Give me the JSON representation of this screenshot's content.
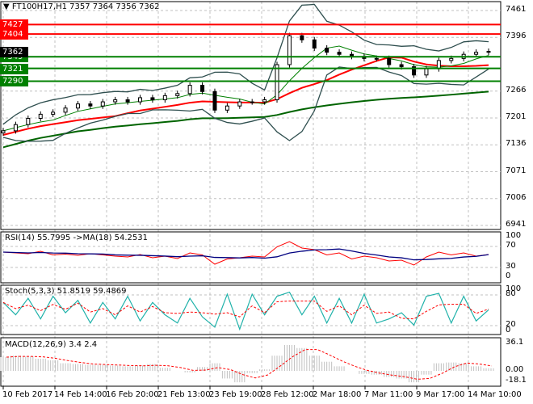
{
  "header": {
    "symbol_line": "FT100H17,H1  7357 7364 7356 7362",
    "menu_icon": "triangle-down-icon"
  },
  "price_axis": {
    "ticks": [
      "7461",
      "7396",
      "7266",
      "7201",
      "7136",
      "7071",
      "7006",
      "6941"
    ],
    "tick_values": [
      7461,
      7396,
      7266,
      7201,
      7136,
      7071,
      7006,
      6941
    ],
    "range": [
      6941,
      7461
    ]
  },
  "levels": [
    {
      "label": "7427",
      "value": 7427,
      "color": "#ff0000"
    },
    {
      "label": "7404",
      "value": 7404,
      "color": "#ff0000"
    },
    {
      "label": "7349",
      "value": 7349,
      "color": "#008000"
    },
    {
      "label": "7321",
      "value": 7321,
      "color": "#008000"
    },
    {
      "label": "7290",
      "value": 7290,
      "color": "#008000"
    }
  ],
  "current_price": {
    "label": "7362",
    "value": 7362
  },
  "chart_data": [
    {
      "type": "candlestick",
      "name": "FT100H17,H1",
      "closes": [
        7170,
        7185,
        7200,
        7210,
        7215,
        7225,
        7235,
        7230,
        7240,
        7245,
        7240,
        7250,
        7245,
        7255,
        7260,
        7280,
        7265,
        7220,
        7230,
        7240,
        7240,
        7245,
        7330,
        7400,
        7390,
        7370,
        7360,
        7355,
        7350,
        7345,
        7345,
        7330,
        7325,
        7305,
        7320,
        7340,
        7345,
        7355,
        7360,
        7362
      ],
      "colors": {
        "candles": "#000000",
        "ma_fast": "#ff0000",
        "ma_slow": "#006400",
        "bands": "#2f4f4f"
      }
    },
    {
      "type": "line",
      "title": "RSI(14) 55.7995  ->MA(18) 54.2531",
      "ylim": [
        0,
        100
      ],
      "ticks": [
        "100",
        "70",
        "30",
        "0"
      ],
      "rsi": [
        62,
        60,
        58,
        64,
        55,
        57,
        54,
        58,
        55,
        52,
        50,
        56,
        48,
        52,
        46,
        60,
        55,
        32,
        45,
        48,
        52,
        50,
        75,
        88,
        72,
        68,
        55,
        60,
        45,
        52,
        48,
        40,
        42,
        30,
        50,
        62,
        55,
        60,
        52,
        56
      ],
      "colors": {
        "rsi": "#ff0000",
        "ma": "#000080"
      }
    },
    {
      "type": "line",
      "title": "Stoch(5,3,3) 51.8519 59.4869",
      "ylim": [
        0,
        100
      ],
      "ticks": [
        "100",
        "80",
        "20",
        "0"
      ],
      "main": [
        70,
        40,
        80,
        30,
        85,
        45,
        75,
        20,
        70,
        30,
        85,
        25,
        70,
        40,
        20,
        80,
        35,
        10,
        90,
        5,
        90,
        40,
        85,
        95,
        40,
        85,
        20,
        80,
        20,
        90,
        20,
        30,
        45,
        15,
        85,
        92,
        20,
        85,
        25,
        52
      ],
      "colors": {
        "main": "#20b2aa",
        "signal": "#ff0000"
      }
    },
    {
      "type": "bar",
      "title": "MACD(12,26,9) 3.4 2.4",
      "ylim": [
        -18.1,
        36.1
      ],
      "ticks": [
        "36.1",
        "0.00",
        "-18.1"
      ],
      "hist": [
        18,
        20,
        19,
        16,
        14,
        10,
        9,
        8,
        8,
        7,
        6,
        7,
        9,
        4,
        0,
        -2,
        5,
        10,
        -10,
        -15,
        -3,
        2,
        20,
        34,
        30,
        20,
        12,
        6,
        0,
        -4,
        -5,
        -8,
        -10,
        -15,
        -5,
        10,
        11,
        10,
        6,
        3.4
      ],
      "colors": {
        "hist": "#c0c0c0",
        "signal": "#ff0000"
      }
    }
  ],
  "time_axis": [
    "10 Feb 2017",
    "14 Feb 14:00",
    "16 Feb 20:00",
    "21 Feb 13:00",
    "23 Feb 19:00",
    "28 Feb 12:00",
    "2 Mar 18:00",
    "7 Mar 11:00",
    "9 Mar 17:00",
    "14 Mar 10:00"
  ]
}
